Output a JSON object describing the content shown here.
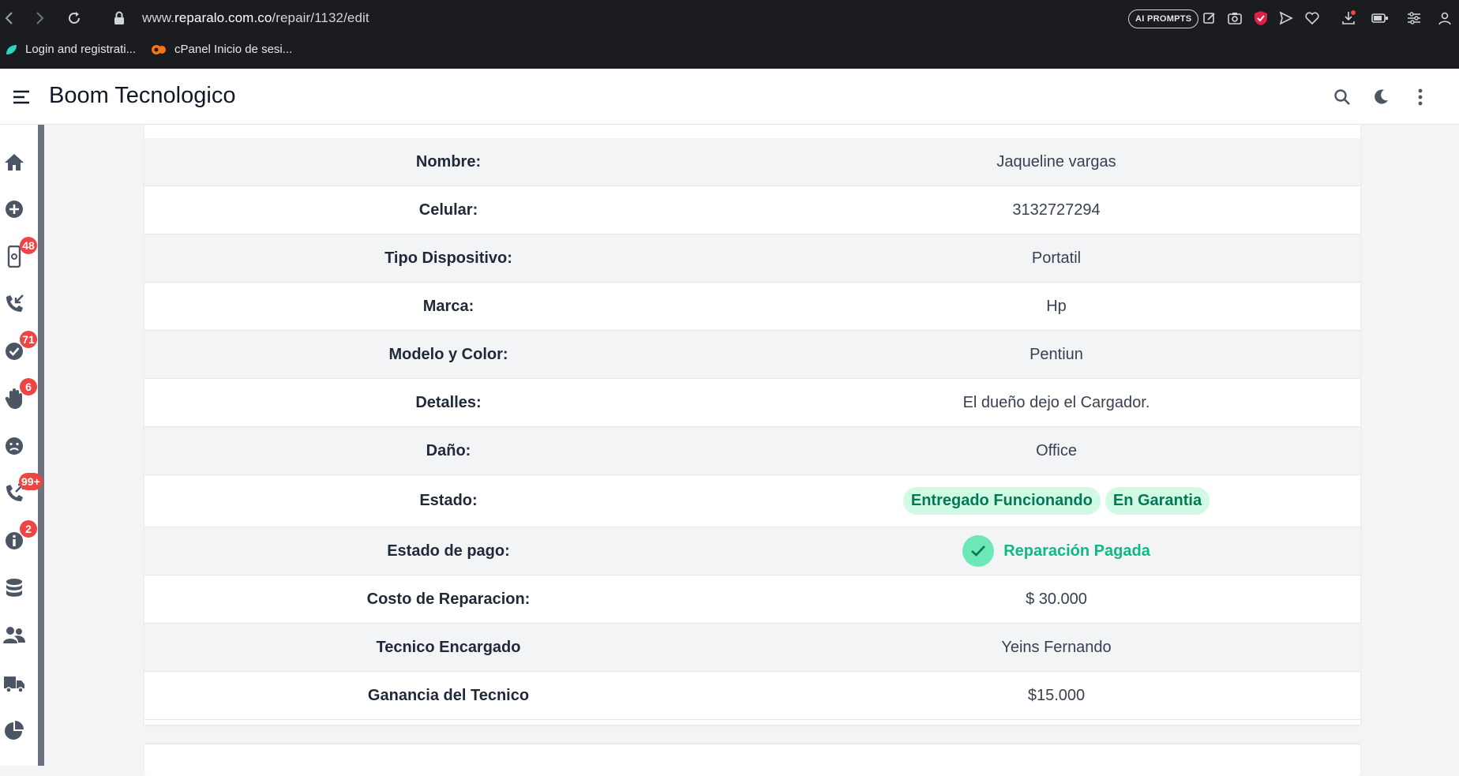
{
  "browser": {
    "url_prefix": "www.",
    "url_domain": "reparalo.com.co",
    "url_path": "/repair/1132/edit",
    "ai_pill": "AI PROMPTS",
    "bookmarks": [
      {
        "label": "Login and registrati..."
      },
      {
        "label": "cPanel Inicio de sesi..."
      }
    ]
  },
  "header": {
    "title": "Boom Tecnologico"
  },
  "sidebar": {
    "items": [
      {
        "icon": "home-icon",
        "badge": ""
      },
      {
        "icon": "plus-circle-icon",
        "badge": ""
      },
      {
        "icon": "phone-repair-icon",
        "badge": "48"
      },
      {
        "icon": "phone-incoming-icon",
        "badge": ""
      },
      {
        "icon": "check-circle-icon",
        "badge": "71"
      },
      {
        "icon": "hand-icon",
        "badge": "6"
      },
      {
        "icon": "sad-face-icon",
        "badge": ""
      },
      {
        "icon": "phone-outgoing-icon",
        "badge": "99+"
      },
      {
        "icon": "info-icon",
        "badge": "2"
      },
      {
        "icon": "database-icon",
        "badge": ""
      },
      {
        "icon": "users-icon",
        "badge": ""
      },
      {
        "icon": "truck-icon",
        "badge": ""
      },
      {
        "icon": "pie-chart-icon",
        "badge": ""
      }
    ]
  },
  "details": {
    "rows": [
      {
        "label": "Nombre:",
        "value": "Jaqueline vargas"
      },
      {
        "label": "Celular:",
        "value": "3132727294"
      },
      {
        "label": "Tipo Dispositivo:",
        "value": "Portatil"
      },
      {
        "label": "Marca:",
        "value": "Hp"
      },
      {
        "label": "Modelo y Color:",
        "value": "Pentiun"
      },
      {
        "label": "Detalles:",
        "value": "El dueño dejo el Cargador."
      },
      {
        "label": "Daño:",
        "value": "Office"
      },
      {
        "label": "Estado:",
        "chips": [
          "Entregado Funcionando",
          "En Garantia"
        ]
      },
      {
        "label": "Estado de pago:",
        "paid": "Reparación Pagada"
      },
      {
        "label": "Costo de Reparacion:",
        "value": "$ 30.000"
      },
      {
        "label": "Tecnico Encargado",
        "value": "Yeins Fernando"
      },
      {
        "label": "Ganancia del Tecnico",
        "value": "$15.000"
      }
    ]
  },
  "colors": {
    "badge": "#ef4444",
    "chip_bg": "#d1fae5",
    "chip_text": "#047857",
    "paid_text": "#10b981"
  }
}
